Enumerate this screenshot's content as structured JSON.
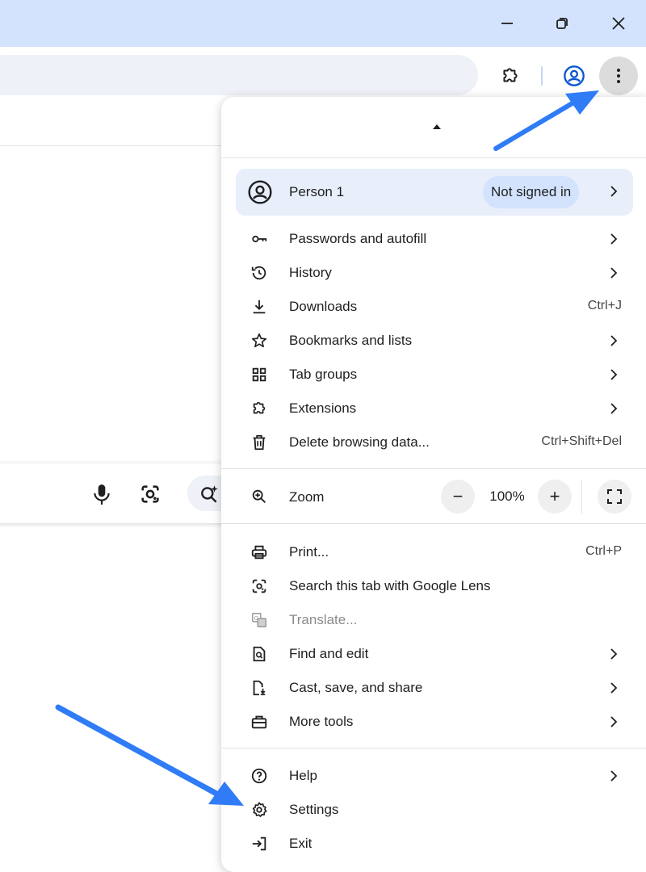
{
  "window": {
    "minimize_icon": "minimize-icon",
    "restore_icon": "restore-icon",
    "close_icon": "close-icon"
  },
  "toolbar": {
    "extensions_icon": "puzzle-icon",
    "profile_icon": "account-circle-icon",
    "menu_icon": "three-dots-vertical-icon"
  },
  "searchbar": {
    "icons": [
      "microphone-icon",
      "lens-camera-icon",
      "ai-search-icon"
    ]
  },
  "menu": {
    "profile": {
      "name": "Person 1",
      "status": "Not signed in"
    },
    "section1": [
      {
        "label": "Passwords and autofill",
        "shortcut": "",
        "submenu": true,
        "icon": "key-icon"
      },
      {
        "label": "History",
        "shortcut": "",
        "submenu": true,
        "icon": "history-icon"
      },
      {
        "label": "Downloads",
        "shortcut": "Ctrl+J",
        "submenu": false,
        "icon": "download-icon"
      },
      {
        "label": "Bookmarks and lists",
        "shortcut": "",
        "submenu": true,
        "icon": "star-icon"
      },
      {
        "label": "Tab groups",
        "shortcut": "",
        "submenu": true,
        "icon": "grid-icon"
      },
      {
        "label": "Extensions",
        "shortcut": "",
        "submenu": true,
        "icon": "puzzle-icon"
      },
      {
        "label": "Delete browsing data...",
        "shortcut": "Ctrl+Shift+Del",
        "submenu": false,
        "icon": "trash-icon"
      }
    ],
    "zoom": {
      "label": "Zoom",
      "value": "100%",
      "minus": "−",
      "plus": "+"
    },
    "section3": [
      {
        "label": "Print...",
        "shortcut": "Ctrl+P",
        "submenu": false,
        "icon": "printer-icon"
      },
      {
        "label": "Search this tab with Google Lens",
        "shortcut": "",
        "submenu": false,
        "icon": "lens-icon"
      },
      {
        "label": "Translate...",
        "shortcut": "",
        "submenu": false,
        "icon": "translate-icon",
        "disabled": true
      },
      {
        "label": "Find and edit",
        "shortcut": "",
        "submenu": true,
        "icon": "find-page-icon"
      },
      {
        "label": "Cast, save, and share",
        "shortcut": "",
        "submenu": true,
        "icon": "cast-save-icon"
      },
      {
        "label": "More tools",
        "shortcut": "",
        "submenu": true,
        "icon": "toolbox-icon"
      }
    ],
    "section4": [
      {
        "label": "Help",
        "shortcut": "",
        "submenu": true,
        "icon": "help-icon"
      },
      {
        "label": "Settings",
        "shortcut": "",
        "submenu": false,
        "icon": "gear-icon"
      },
      {
        "label": "Exit",
        "shortcut": "",
        "submenu": false,
        "icon": "exit-icon"
      }
    ]
  },
  "colors": {
    "titlebar": "#d3e3fd",
    "profile_bg": "#e8eefa",
    "badge_bg": "#d3e3fd",
    "arrow": "#2f7cf6"
  }
}
